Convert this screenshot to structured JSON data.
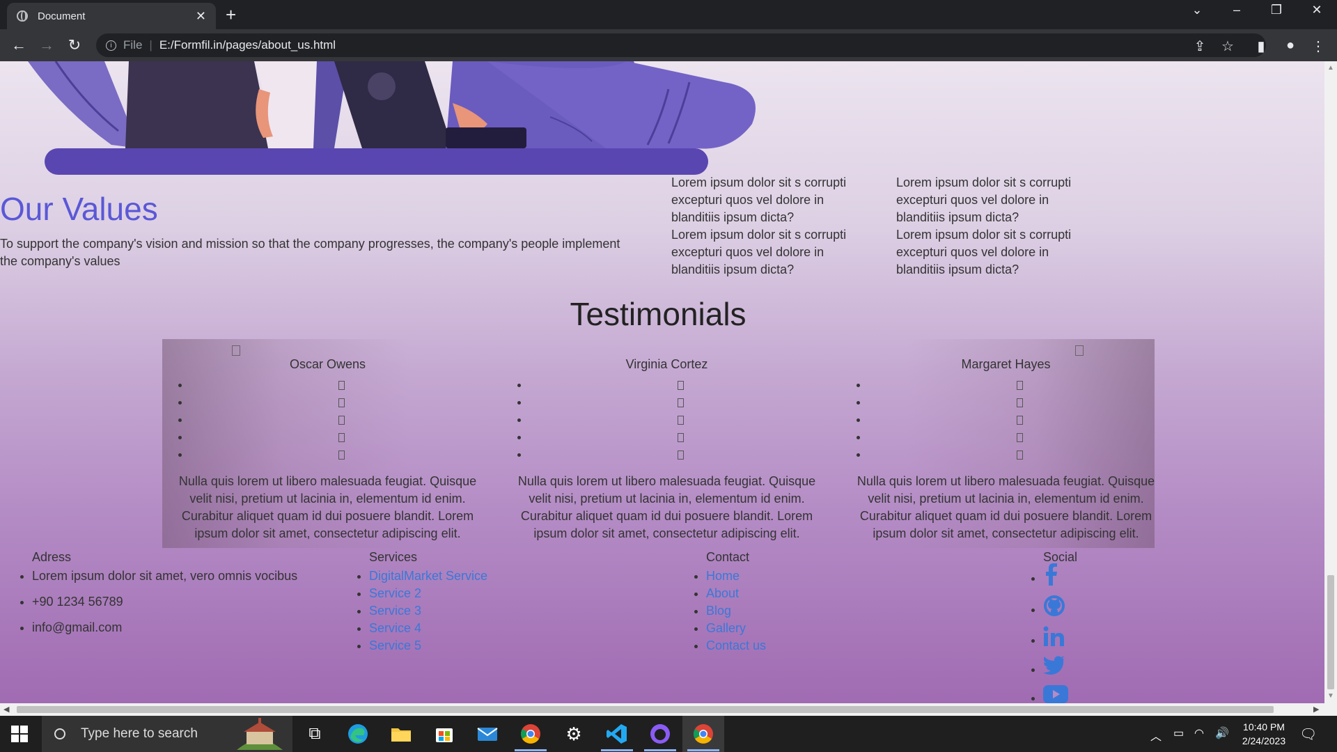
{
  "browser": {
    "tab_title": "Document",
    "url_scheme": "File",
    "url": "E:/Formfil.in/pages/about_us.html"
  },
  "values": {
    "title": "Our Values",
    "text": "To support the company's vision and mission so that the company progresses, the company's people implement the company's values",
    "columns": [
      [
        "Lorem ipsum dolor sit s corrupti excepturi quos vel dolore in blanditiis ipsum dicta?",
        "Lorem ipsum dolor sit s corrupti excepturi quos vel dolore in blanditiis ipsum dicta?"
      ],
      [
        "Lorem ipsum dolor sit s corrupti excepturi quos vel dolore in blanditiis ipsum dicta?",
        "Lorem ipsum dolor sit s corrupti excepturi quos vel dolore in blanditiis ipsum dicta?"
      ]
    ]
  },
  "testimonials": {
    "title": "Testimonials",
    "items": [
      {
        "name": "Oscar Owens",
        "quote": "Nulla quis lorem ut libero malesuada feugiat. Quisque velit nisi, pretium ut lacinia in, elementum id enim. Curabitur aliquet quam id dui posuere blandit. Lorem ipsum dolor sit amet, consectetur adipiscing elit."
      },
      {
        "name": "Virginia Cortez",
        "quote": "Nulla quis lorem ut libero malesuada feugiat. Quisque velit nisi, pretium ut lacinia in, elementum id enim. Curabitur aliquet quam id dui posuere blandit. Lorem ipsum dolor sit amet, consectetur adipiscing elit."
      },
      {
        "name": "Margaret Hayes",
        "quote": "Nulla quis lorem ut libero malesuada feugiat. Quisque velit nisi, pretium ut lacinia in, elementum id enim. Curabitur aliquet quam id dui posuere blandit. Lorem ipsum dolor sit amet, consectetur adipiscing elit."
      }
    ]
  },
  "footer": {
    "address": {
      "heading": "Adress",
      "items": [
        "Lorem ipsum dolor sit amet, vero omnis vocibus",
        "+90 1234 56789",
        "info@gmail.com"
      ]
    },
    "services": {
      "heading": "Services",
      "items": [
        "DigitalMarket Service",
        "Service 2",
        "Service 3",
        "Service 4",
        "Service 5"
      ]
    },
    "contact": {
      "heading": "Contact",
      "items": [
        "Home",
        "About",
        "Blog",
        "Gallery",
        "Contact us"
      ]
    },
    "social": {
      "heading": "Social",
      "icons": [
        "facebook-icon",
        "github-icon",
        "linkedin-icon",
        "twitter-icon",
        "youtube-icon"
      ]
    },
    "link_color": "#3a78d8"
  },
  "taskbar": {
    "search_placeholder": "Type here to search",
    "time": "10:40 PM",
    "date": "2/24/2023"
  }
}
